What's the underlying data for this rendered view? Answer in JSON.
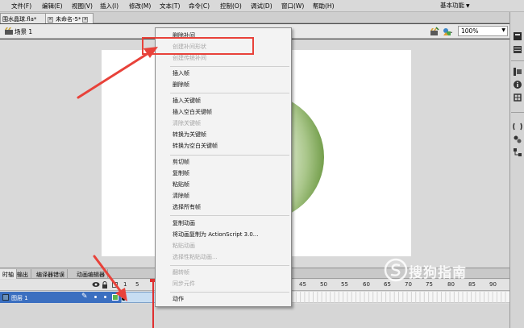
{
  "menubar": {
    "items": [
      {
        "label": "文件(F)"
      },
      {
        "label": "编辑(E)"
      },
      {
        "label": "视图(V)"
      },
      {
        "label": "插入(I)"
      },
      {
        "label": "修改(M)"
      },
      {
        "label": "文本(T)"
      },
      {
        "label": "命令(C)"
      },
      {
        "label": "控制(O)"
      },
      {
        "label": "调试(D)"
      },
      {
        "label": "窗口(W)"
      },
      {
        "label": "帮助(H)"
      }
    ],
    "workspace_label": "基本功能"
  },
  "doc_tabs": [
    {
      "label": "围水晶球.fla*"
    },
    {
      "label": "未命名-5*"
    }
  ],
  "scene": {
    "label": "场景 1",
    "zoom": "100%"
  },
  "context_menu": {
    "items": [
      {
        "label": "删除补间",
        "enabled": true
      },
      {
        "label": "创建补间形状",
        "enabled": false,
        "highlighted": true
      },
      {
        "label": "创建传统补间",
        "enabled": false
      },
      {
        "label": "插入帧",
        "enabled": true
      },
      {
        "label": "删除帧",
        "enabled": true
      },
      {
        "label": "插入关键帧",
        "enabled": true
      },
      {
        "label": "插入空白关键帧",
        "enabled": true
      },
      {
        "label": "清除关键帧",
        "enabled": false
      },
      {
        "label": "转换为关键帧",
        "enabled": true
      },
      {
        "label": "转换为空白关键帧",
        "enabled": true
      },
      {
        "label": "剪切帧",
        "enabled": true
      },
      {
        "label": "复制帧",
        "enabled": true
      },
      {
        "label": "粘贴帧",
        "enabled": true
      },
      {
        "label": "清除帧",
        "enabled": true
      },
      {
        "label": "选择所有帧",
        "enabled": true
      },
      {
        "label": "复制动画",
        "enabled": true
      },
      {
        "label": "将动画复制为 ActionScript 3.0...",
        "enabled": true
      },
      {
        "label": "粘贴动画",
        "enabled": false
      },
      {
        "label": "选择性粘贴动画...",
        "enabled": false
      },
      {
        "label": "翻转帧",
        "enabled": false
      },
      {
        "label": "同步元件",
        "enabled": false
      },
      {
        "label": "动作",
        "enabled": true
      }
    ]
  },
  "timeline": {
    "tabs": [
      {
        "label": "时轴"
      },
      {
        "label": "输出"
      },
      {
        "label": "编译器错误"
      },
      {
        "label": "动画编辑器"
      }
    ],
    "frame_numbers": [
      "1",
      "5",
      "45",
      "50",
      "55",
      "60",
      "65",
      "70",
      "75",
      "80",
      "85",
      "90"
    ],
    "layer": {
      "name": "图层 1"
    }
  },
  "watermark": {
    "text": "搜狗指南"
  },
  "colors": {
    "highlight_box": "#e8423a",
    "arrow": "#e8423a",
    "sphere_green": "#6a9a3c",
    "layer_selected": "#3b6fc0"
  }
}
